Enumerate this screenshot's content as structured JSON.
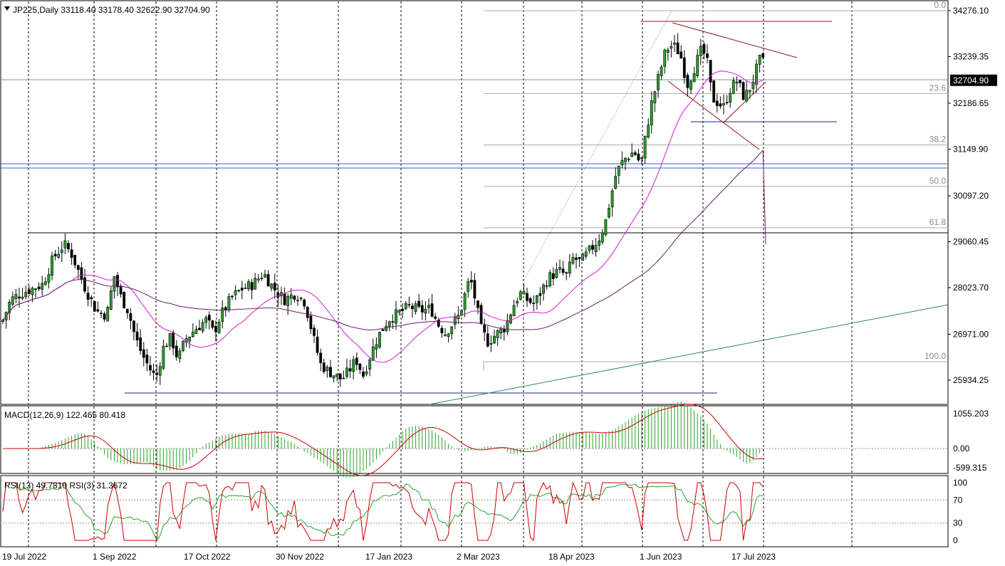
{
  "header": {
    "symbol_line": "JP225,Daily  33118.40 33178.40 32622.90 32704.90"
  },
  "price_axis": {
    "ticks": [
      {
        "label": "34276.10",
        "value": 34276.1
      },
      {
        "label": "33239.35",
        "value": 33239.35
      },
      {
        "label": "32186.65",
        "value": 32186.65
      },
      {
        "label": "31149.90",
        "value": 31149.9
      },
      {
        "label": "30097.20",
        "value": 30097.2
      },
      {
        "label": "29060.45",
        "value": 29060.45
      },
      {
        "label": "28023.70",
        "value": 28023.7
      },
      {
        "label": "26971.00",
        "value": 26971.0
      },
      {
        "label": "25934.25",
        "value": 25934.25
      }
    ],
    "current_price_label": "32704.90",
    "current_price": 32704.9,
    "current_price_bg": "#000000"
  },
  "fibonacci": {
    "levels": [
      {
        "label": "0.0",
        "value": 34276.1
      },
      {
        "label": "23.6",
        "value": 32405
      },
      {
        "label": "38.2",
        "value": 31245
      },
      {
        "label": "50.0",
        "value": 30310
      },
      {
        "label": "61.8",
        "value": 29375
      },
      {
        "label": "100.0",
        "value": 26350
      }
    ],
    "color": "#aaaaaa"
  },
  "macd": {
    "label": "MACD(12,26,9) 122.465 80.418",
    "ticks": [
      {
        "label": "1055.203",
        "value": 1055.203
      },
      {
        "label": "0.00",
        "value": 0
      },
      {
        "label": "-599.315",
        "value": -599.315
      }
    ],
    "histogram_color": "#2ca02c",
    "signal_color": "#cc0000"
  },
  "rsi": {
    "label": "RSI(13) 49.7810  RSI(3) 31.3672",
    "ticks": [
      {
        "label": "100",
        "value": 100
      },
      {
        "label": "70",
        "value": 70
      },
      {
        "label": "30",
        "value": 30
      },
      {
        "label": "0",
        "value": 0
      }
    ],
    "rsi13_color": "#2ca02c",
    "rsi3_color": "#cc0000"
  },
  "time_axis": {
    "labels": [
      "19 Jul 2022",
      "1 Sep 2022",
      "17 Oct 2022",
      "30 Nov 2022",
      "17 Jan 2023",
      "2 Mar 2023",
      "18 Apr 2023",
      "1 Jun 2023",
      "17 Jul 2023"
    ]
  },
  "colors": {
    "bull_candle": "#2ca02c",
    "bear_candle": "#000000",
    "ma_fast": "#d61bd6",
    "ma_slow": "#6a1b6a",
    "trend_line": "#2e8b57",
    "support_line": "#1a237e",
    "resistance_line": "#8b1a1a"
  }
}
